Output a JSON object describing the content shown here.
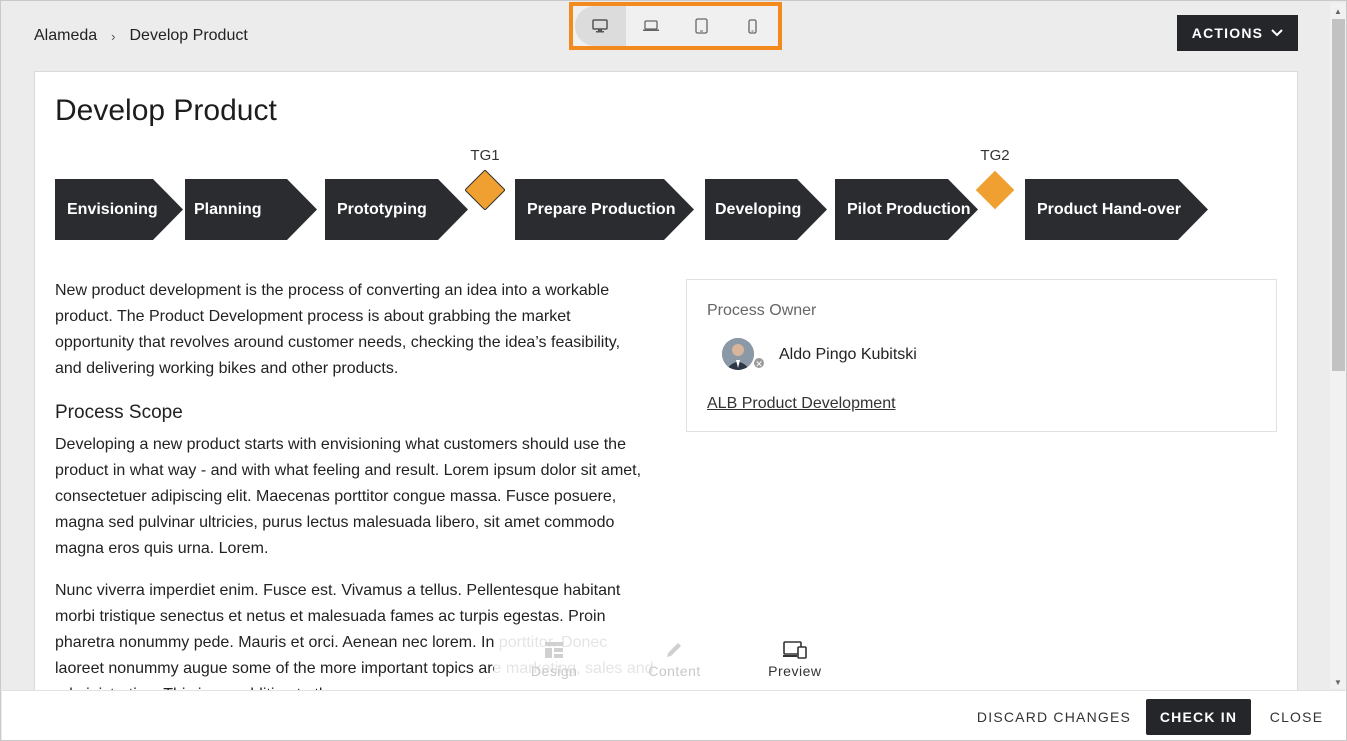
{
  "breadcrumb": {
    "root": "Alameda",
    "separator": "›",
    "current": "Develop Product"
  },
  "device_switcher": {
    "devices": [
      {
        "name": "desktop",
        "icon": "desktop-icon",
        "active": true
      },
      {
        "name": "laptop",
        "icon": "laptop-icon",
        "active": false
      },
      {
        "name": "tablet",
        "icon": "tablet-icon",
        "active": false
      },
      {
        "name": "phone",
        "icon": "phone-icon",
        "active": false
      }
    ],
    "highlight_color": "#f28a1d"
  },
  "header": {
    "actions_label": "ACTIONS"
  },
  "page": {
    "title": "Develop Product",
    "phases": [
      "Envisioning",
      "Planning",
      "Prototyping",
      "Prepare Production",
      "Developing",
      "Pilot Production",
      "Product Hand-over"
    ],
    "gates": [
      "TG1",
      "TG2"
    ],
    "intro": "New product development is the process of converting an idea into a workable product. The Product Development process is about grabbing the market opportunity that revolves around customer needs, checking the idea’s feasibility, and delivering working bikes and other products.",
    "scope_heading": "Process Scope",
    "scope_text_1": "Developing a new product starts with envisioning what customers should use the product in what way - and with what feeling and result. Lorem ipsum dolor sit amet, consectetuer adipiscing elit. Maecenas porttitor congue massa. Fusce posuere, magna sed pulvinar ultricies, purus lectus malesuada libero, sit amet commodo magna eros quis urna. Lorem.",
    "scope_text_2": "Nunc viverra imperdiet enim. Fusce est. Vivamus a tellus. Pellentesque habitant morbi tristique senectus et netus et malesuada fames ac turpis egestas. Proin pharetra nonummy pede. Mauris et orci. Aenean nec lorem. In porttitor. Donec laoreet nonummy augue some of the more important topics are marketing, sales and administration. This is an addition to the"
  },
  "owner_panel": {
    "heading": "Process Owner",
    "name": "Aldo Pingo Kubitski",
    "org_link": "ALB Product Development"
  },
  "mode_bar": {
    "modes": [
      {
        "label": "Design",
        "icon": "design-icon",
        "active": false
      },
      {
        "label": "Content",
        "icon": "pencil-icon",
        "active": false
      },
      {
        "label": "Preview",
        "icon": "devices-icon",
        "active": true
      }
    ]
  },
  "footer": {
    "discard_label": "DISCARD CHANGES",
    "checkin_label": "CHECK IN",
    "close_label": "CLOSE"
  },
  "colors": {
    "phase_fill": "#2a2c30",
    "gate_fill": "#f0a030",
    "dark_button": "#242629"
  }
}
